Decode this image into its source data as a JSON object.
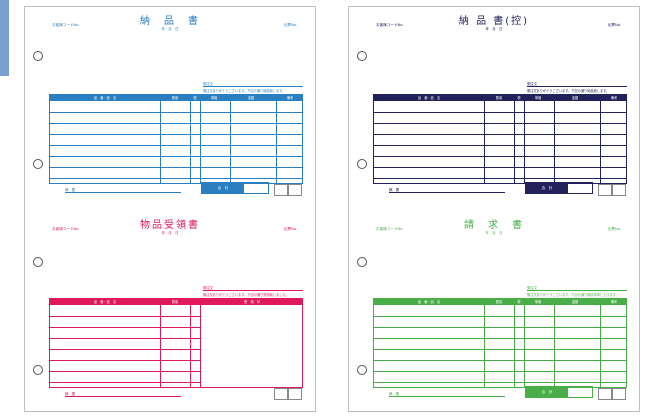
{
  "colors": {
    "blue": "#2a7fc1",
    "navy": "#23215a",
    "pink": "#e0195a",
    "green": "#4aae48"
  },
  "forms": {
    "delivery": {
      "title": "納　品　書",
      "customer_code": "お客様コードNo.",
      "slip_no": "伝票No.",
      "date": "年　月　日",
      "recipient": "御注文",
      "notice": "御注文ありがとうございます。下記の通り納品致します。",
      "headers": {
        "item": "品　番・品　名",
        "qty": "数量",
        "unit": "単価",
        "amount": "金額",
        "tax": "税",
        "note": "備考"
      },
      "memo": "摘　要",
      "total": "合　計"
    },
    "delivery_copy": {
      "title": "納 品 書(控)",
      "customer_code": "お客様コードNo.",
      "slip_no": "伝票No.",
      "date": "年　月　日",
      "recipient": "御注文",
      "notice": "御注文ありがとうございます。下記の通り納品致します。",
      "headers": {
        "item": "品　番・品　名",
        "qty": "数量",
        "unit": "単価",
        "amount": "金額",
        "tax": "税",
        "note": "備考"
      },
      "memo": "摘　要",
      "total": "合　計"
    },
    "receipt": {
      "title": "物品受領書",
      "customer_code": "お客様コードNo.",
      "slip_no": "伝票No.",
      "date": "年　月　日",
      "recipient": "御注文",
      "notice": "御注文ありがとうございます。下記の通り受領致しました。",
      "headers": {
        "item": "品　番・品　名",
        "qty": "数量",
        "receipt": "受　領　印"
      },
      "memo": "摘　要"
    },
    "invoice": {
      "title": "請　求　書",
      "customer_code": "お客様コードNo.",
      "slip_no": "伝票No.",
      "date": "年　月　日",
      "recipient": "御注文",
      "notice": "御注文ありがとうございます。下記の通り御請求申し上げます。",
      "headers": {
        "item": "品　番・品　名",
        "qty": "数量",
        "unit": "単価",
        "amount": "金額",
        "tax": "税",
        "note": "備考"
      },
      "memo": "摘　要",
      "total": "合　計"
    }
  }
}
